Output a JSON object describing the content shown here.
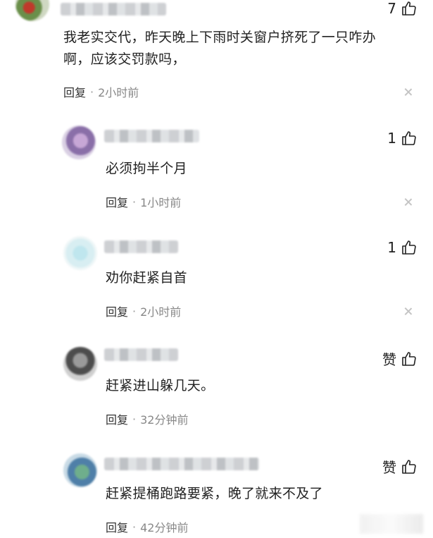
{
  "comments": [
    {
      "likes": "7",
      "text_line1": "我老实交代，昨天晚上下雨时关窗户挤死了一只咋办",
      "text_line2": "啊，应该交罚款吗，",
      "reply_label": "回复",
      "time": "2小时前"
    },
    {
      "likes": "1",
      "text": "必须拘半个月",
      "reply_label": "回复",
      "time": "1小时前"
    },
    {
      "likes": "1",
      "text": "劝你赶紧自首",
      "reply_label": "回复",
      "time": "2小时前"
    },
    {
      "likes": "赞",
      "text": "赶紧进山躲几天。",
      "reply_label": "回复",
      "time": "32分钟前"
    },
    {
      "likes": "赞",
      "text": "赶紧提桶跑路要紧，晚了就来不及了",
      "reply_label": "回复",
      "time": "42分钟前"
    }
  ],
  "icons": {
    "like": "thumbs-up-icon",
    "close": "close-icon"
  }
}
